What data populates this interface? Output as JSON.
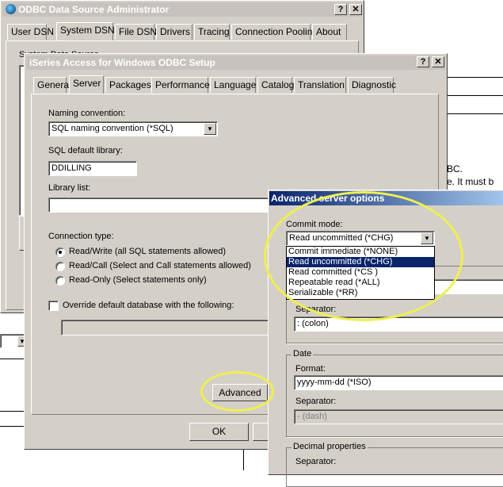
{
  "odbc_admin": {
    "title": "ODBC Data Source Administrator",
    "tabs": [
      "User DSN",
      "System DSN",
      "File DSN",
      "Drivers",
      "Tracing",
      "Connection Pooling",
      "About"
    ],
    "partial_label": "System Data Source"
  },
  "background_doc": {
    "text1": "BC.",
    "text2": "e.  It must b"
  },
  "setup": {
    "title": "iSeries Access for Windows ODBC Setup",
    "tabs": [
      "General",
      "Server",
      "Packages",
      "Performance",
      "Language",
      "Catalog",
      "Translation",
      "Diagnostic"
    ],
    "naming_label": "Naming convention:",
    "naming_value": "SQL naming convention  (*SQL)",
    "library_label": "SQL default library:",
    "library_value": "DDILLING",
    "library_list_label": "Library list:",
    "library_list_value": "",
    "conn_type_label": "Connection type:",
    "conn_options": [
      "Read/Write (all SQL statements allowed)",
      "Read/Call (Select and Call statements allowed)",
      "Read-Only (Select statements only)"
    ],
    "override_label": "Override default database with the following:",
    "override_value": "",
    "advanced_label": "Advanced",
    "ok_label": "OK"
  },
  "advanced": {
    "title": "Advanced server options",
    "commit_label": "Commit mode:",
    "commit_value": "Read uncommitted  (*CHG)",
    "commit_options": [
      "Commit immediate  (*NONE)",
      "Read uncommitted  (*CHG)",
      "Read committed  (*CS )",
      "Repeatable read  (*ALL)",
      "Serializable  (*RR)"
    ],
    "time_separator_label": "Separator:",
    "time_separator_value": ":  (colon)",
    "date_group": "Date",
    "date_format_label": "Format:",
    "date_format_value": "yyyy-mm-dd  (*ISO)",
    "date_separator_label": "Separator:",
    "date_separator_value": "-  (dash)",
    "decimal_group": "Decimal properties",
    "decimal_separator_label": "Separator:"
  },
  "colors": {
    "highlight_ellipse": "#f0ef50",
    "active_title": "#0a246a",
    "inactive_title": "#c7c2bd",
    "window_face": "#d4d0c8"
  }
}
